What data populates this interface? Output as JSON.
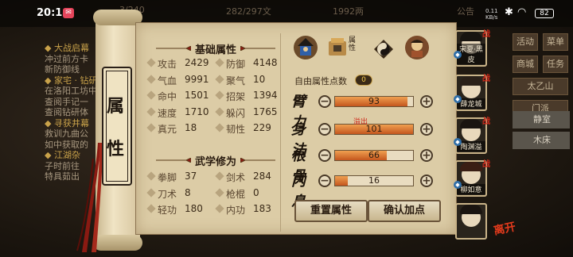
{
  "status_bar": {
    "time": "20:14",
    "speed_top": "0.11",
    "speed_bottom": "KB/s",
    "battery": "82"
  },
  "background": {
    "top_strip": [
      "3/240",
      "282/297文",
      "1992两",
      "公告"
    ],
    "quests": [
      {
        "text": "◆ 大战启幕",
        "header": true
      },
      {
        "text": "冲过前方卡",
        "header": false
      },
      {
        "text": "新防御线",
        "header": false
      },
      {
        "text": "◆ 家宅 · 钻研",
        "header": true
      },
      {
        "text": "在洛阳工坊中",
        "header": false
      },
      {
        "text": "查阅手记一",
        "header": false
      },
      {
        "text": "查阅钻研体",
        "header": false
      },
      {
        "text": "◆ 寻获井幕",
        "header": true
      },
      {
        "text": "救训九曲公",
        "header": false
      },
      {
        "text": "如中获取的",
        "header": false
      },
      {
        "text": "◆ 江湖杂",
        "header": true
      },
      {
        "text": "子时前往",
        "header": false
      },
      {
        "text": "特具茹出",
        "header": false
      }
    ],
    "side_buttons": [
      "活动",
      "菜单",
      "商城",
      "任务",
      "太乙山",
      "门派"
    ],
    "side_tabs": [
      "静室",
      "木床"
    ]
  },
  "scroll_title": [
    "属",
    "性"
  ],
  "basic": {
    "title": "基础属性",
    "stats": [
      {
        "name": "攻击",
        "value": "2429"
      },
      {
        "name": "防御",
        "value": "4148"
      },
      {
        "name": "气血",
        "value": "9991"
      },
      {
        "name": "聚气",
        "value": "10"
      },
      {
        "name": "命中",
        "value": "1501"
      },
      {
        "name": "招架",
        "value": "1394"
      },
      {
        "name": "速度",
        "value": "1710"
      },
      {
        "name": "躲闪",
        "value": "1765"
      },
      {
        "name": "真元",
        "value": "18"
      },
      {
        "name": "韧性",
        "value": "229"
      }
    ]
  },
  "martial": {
    "title": "武学修为",
    "stats": [
      {
        "name": "拳脚",
        "value": "37"
      },
      {
        "name": "剑术",
        "value": "284"
      },
      {
        "name": "刀术",
        "value": "8"
      },
      {
        "name": "枪棍",
        "value": "0"
      },
      {
        "name": "轻功",
        "value": "180"
      },
      {
        "name": "内功",
        "value": "183"
      }
    ]
  },
  "tabs": [
    {
      "icon": "character-icon",
      "label": ""
    },
    {
      "icon": "equipment-icon",
      "label": "属性"
    },
    {
      "icon": "taiji-icon",
      "label": ""
    },
    {
      "icon": "companion-icon",
      "label": ""
    }
  ],
  "free_points": {
    "label": "自由属性点数",
    "value": "0"
  },
  "allocations": [
    {
      "label": "臂力",
      "value": "93",
      "fill": 0.93
    },
    {
      "label": "身法",
      "value": "101",
      "fill": 1.0,
      "note": "溢出"
    },
    {
      "label": "根骨",
      "value": "66",
      "fill": 0.66
    },
    {
      "label": "内息",
      "value": "16",
      "fill": 0.16
    }
  ],
  "buttons": {
    "reset": "重置属性",
    "confirm": "确认加点"
  },
  "party": [
    {
      "name": "宋夏·黑皮",
      "badge": "战"
    },
    {
      "name": "薛龙城",
      "badge": "战"
    },
    {
      "name": "陶渊溢",
      "badge": "战"
    },
    {
      "name": "柳如意",
      "badge": "战"
    },
    {
      "name": "",
      "badge": ""
    }
  ],
  "leave_label": "离开"
}
